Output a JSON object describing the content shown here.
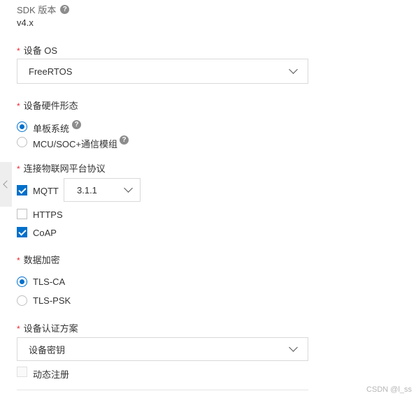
{
  "sdk": {
    "label": "SDK 版本",
    "value": "v4.x",
    "help_icon": "question-circle-icon"
  },
  "device_os": {
    "required_mark": "*",
    "label": "设备 OS",
    "selected": "FreeRTOS"
  },
  "hardware_form": {
    "required_mark": "*",
    "label": "设备硬件形态",
    "options": [
      {
        "label": "单板系统",
        "checked": true
      },
      {
        "label": "MCU/SOC+通信模组",
        "checked": false
      }
    ]
  },
  "protocol": {
    "required_mark": "*",
    "label": "连接物联网平台协议",
    "options": [
      {
        "label": "MQTT",
        "checked": true
      },
      {
        "label": "HTTPS",
        "checked": false
      },
      {
        "label": "CoAP",
        "checked": true
      }
    ],
    "mqtt_version": "3.1.1"
  },
  "encryption": {
    "required_mark": "*",
    "label": "数据加密",
    "options": [
      {
        "label": "TLS-CA",
        "checked": true
      },
      {
        "label": "TLS-PSK",
        "checked": false
      }
    ]
  },
  "auth": {
    "required_mark": "*",
    "label": "设备认证方案",
    "selected": "设备密钥",
    "dynamic_register_label": "动态注册",
    "dynamic_register_checked": false
  },
  "watermark": "CSDN @l_ss",
  "colors": {
    "accent": "#0070cc",
    "required": "#f5222d",
    "border": "#d9d9d9"
  }
}
